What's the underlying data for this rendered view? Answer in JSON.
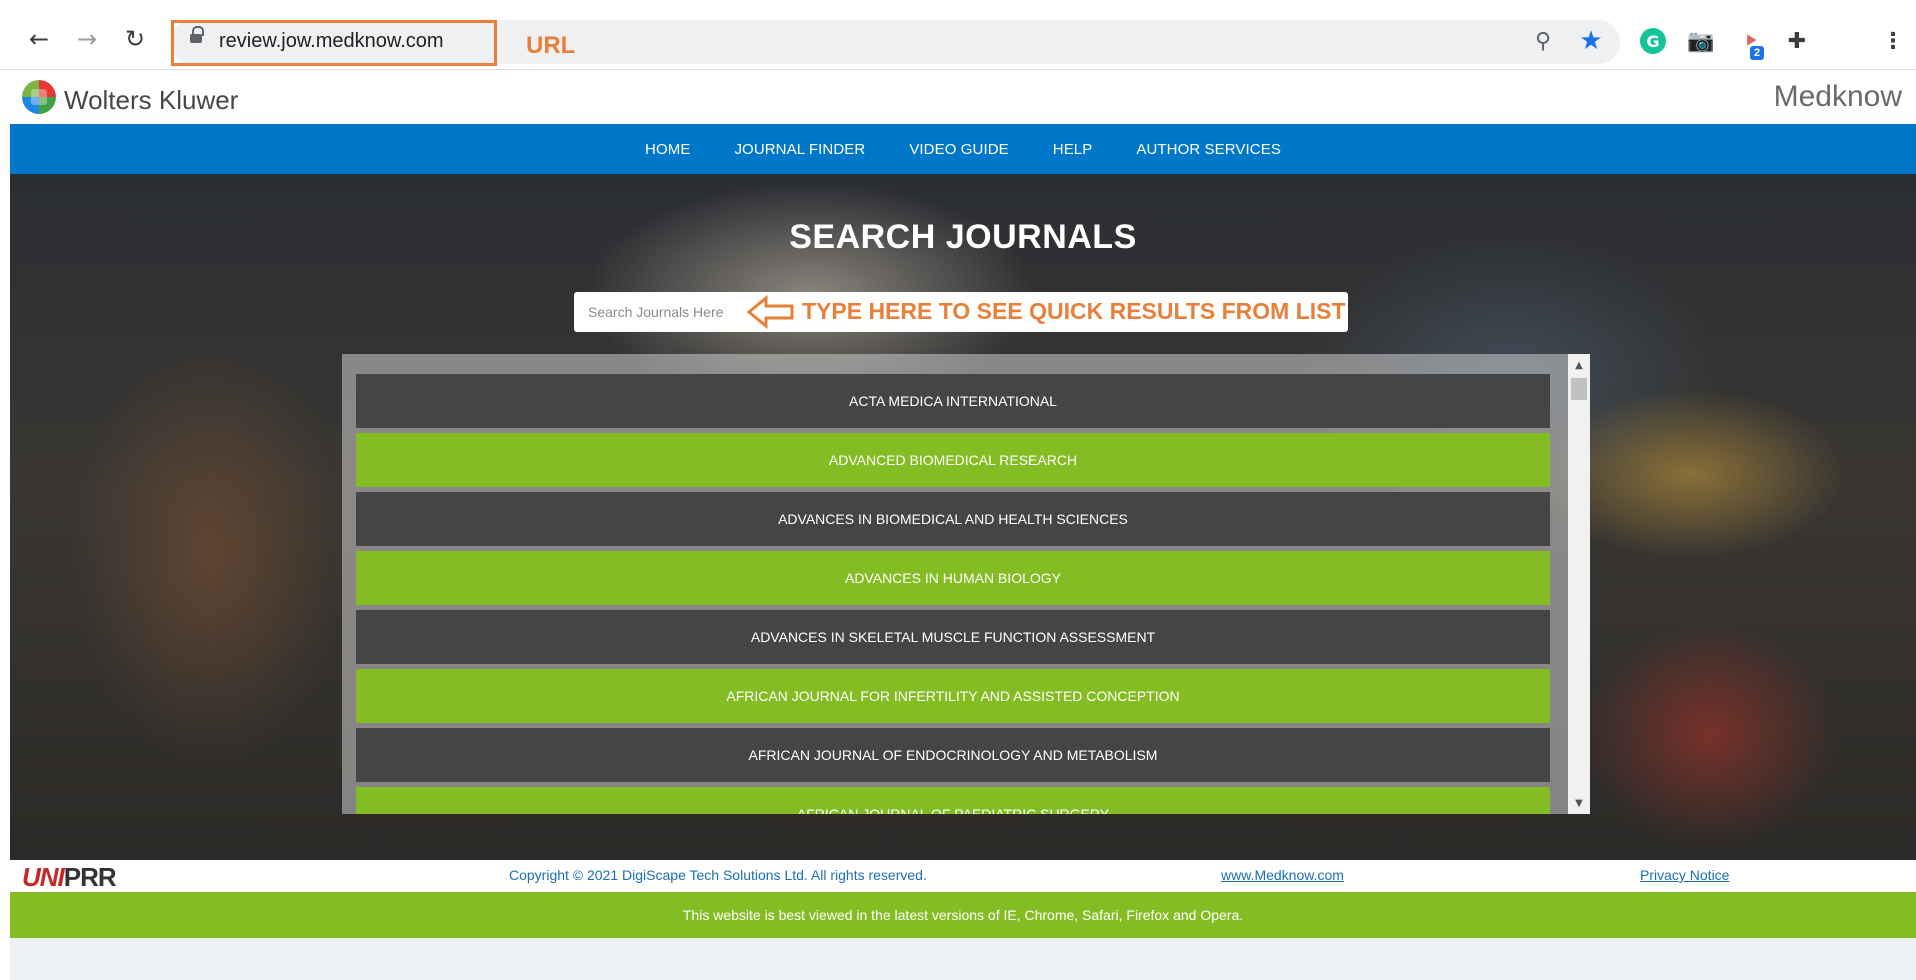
{
  "browser": {
    "url": "review.jow.medknow.com",
    "url_annotation": "URL",
    "extension_badge": "2"
  },
  "header": {
    "logo_text": "Wolters Kluwer",
    "brand": "Medknow"
  },
  "nav": {
    "items": [
      "HOME",
      "JOURNAL FINDER",
      "VIDEO GUIDE",
      "HELP",
      "AUTHOR SERVICES"
    ]
  },
  "hero": {
    "title": "SEARCH JOURNALS",
    "search_placeholder": "Search Journals Here",
    "search_annotation": "TYPE HERE TO SEE QUICK RESULTS FROM LIST"
  },
  "journals": [
    "ACTA MEDICA INTERNATIONAL",
    "ADVANCED BIOMEDICAL RESEARCH",
    "ADVANCES IN BIOMEDICAL AND HEALTH SCIENCES",
    "ADVANCES IN HUMAN BIOLOGY",
    "ADVANCES IN SKELETAL MUSCLE FUNCTION ASSESSMENT",
    "AFRICAN JOURNAL FOR INFERTILITY AND ASSISTED CONCEPTION",
    "AFRICAN JOURNAL OF ENDOCRINOLOGY AND METABOLISM",
    "AFRICAN JOURNAL OF PAEDIATRIC SURGERY"
  ],
  "footer": {
    "logo_uni": "UNI",
    "logo_prr": "PRR",
    "copyright": "Copyright © 2021 DigiScape Tech Solutions Ltd. All rights reserved.",
    "site_link": "www.Medknow.com",
    "privacy": "Privacy Notice",
    "browser_note": "This website is best viewed in the latest versions of IE, Chrome, Safari, Firefox and Opera."
  },
  "colors": {
    "nav_blue": "#0077c8",
    "accent_green": "#84bd23",
    "row_dark": "#454545",
    "annotation_orange": "#e8803a"
  }
}
